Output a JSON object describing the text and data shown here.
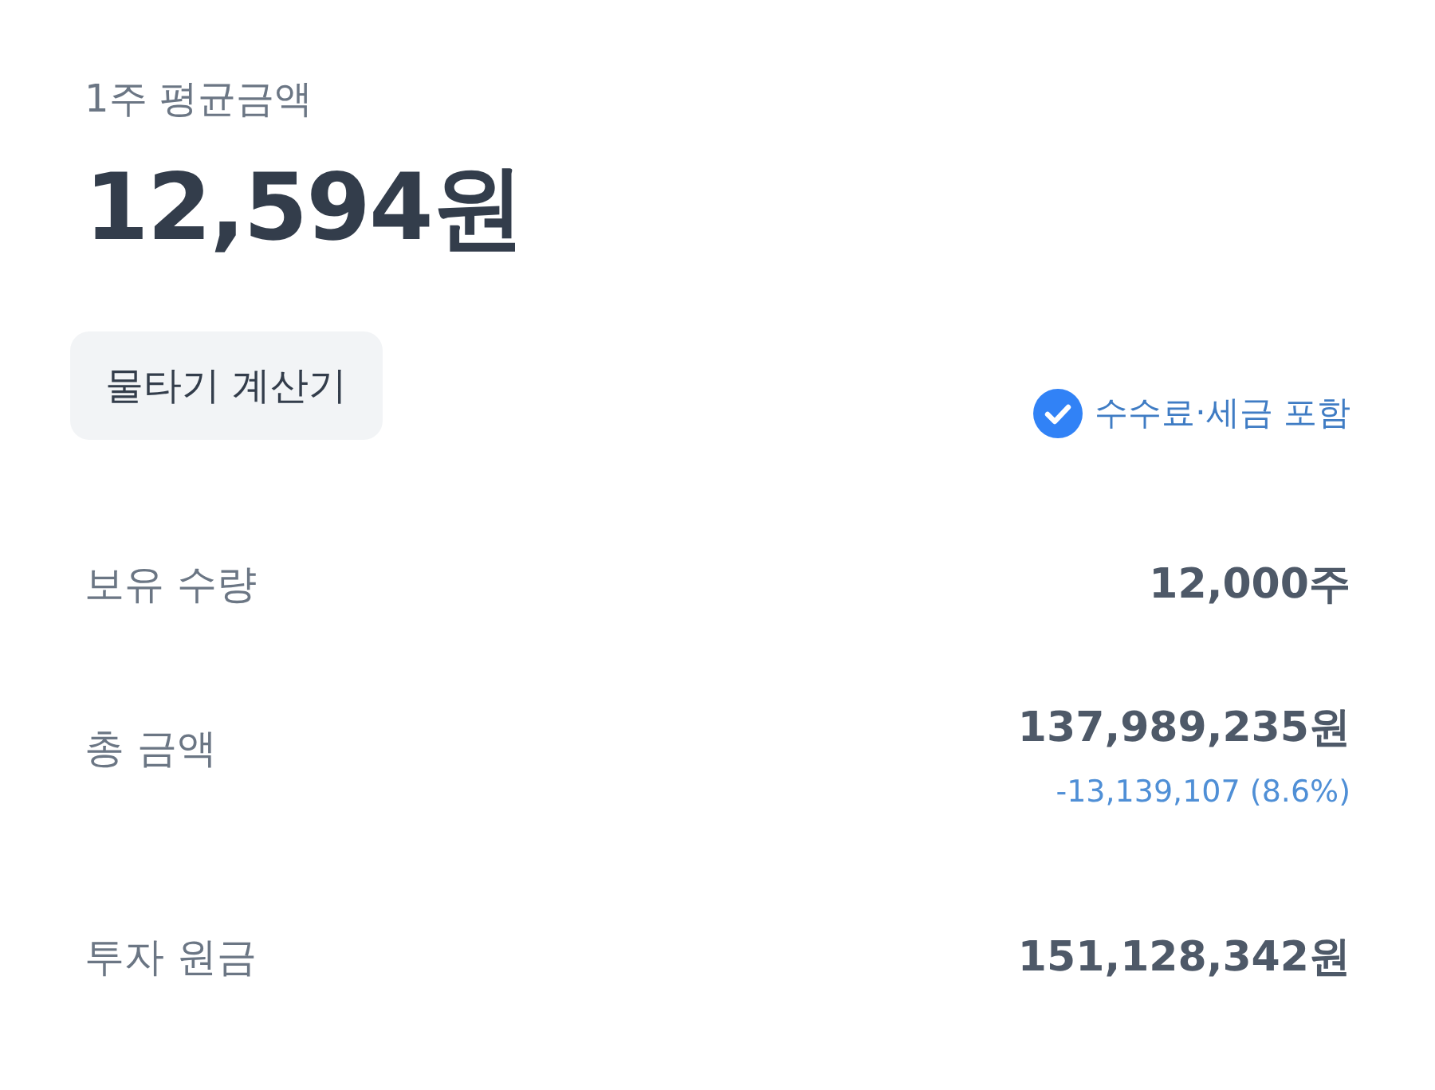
{
  "title": "1주 평균금액",
  "average_price": "12,594원",
  "calculator_button": "물타기 계산기",
  "fee_tax_option": {
    "label": "수수료·세금 포함",
    "checked": true
  },
  "rows": [
    {
      "label": "보유 수량",
      "value": "12,000주"
    },
    {
      "label": "총 금액",
      "value": "137,989,235원",
      "change": "-13,139,107 (8.6%)"
    },
    {
      "label": "투자 원금",
      "value": "151,128,342원"
    }
  ]
}
